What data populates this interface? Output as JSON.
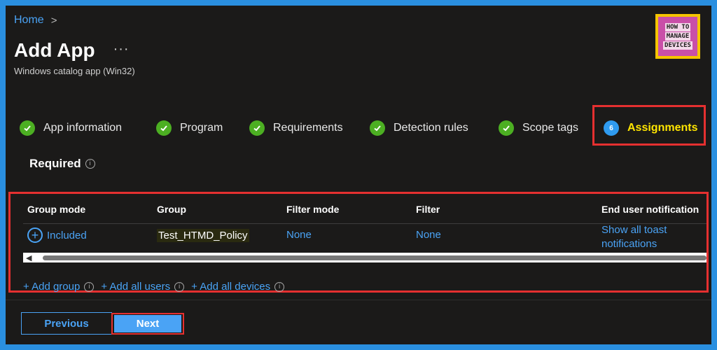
{
  "breadcrumb": {
    "home": "Home",
    "separator": ">"
  },
  "page": {
    "title": "Add App",
    "more": "···",
    "subtitle": "Windows catalog app (Win32)"
  },
  "logo": {
    "line1": "HOW TO",
    "line2": "MANAGE",
    "line3": "DEVICES"
  },
  "steps": [
    {
      "label": "App information",
      "state": "complete"
    },
    {
      "label": "Program",
      "state": "complete"
    },
    {
      "label": "Requirements",
      "state": "complete"
    },
    {
      "label": "Detection rules",
      "state": "complete"
    },
    {
      "label": "Scope tags",
      "state": "complete"
    },
    {
      "label": "Assignments",
      "state": "active",
      "number": "6"
    }
  ],
  "section": {
    "title": "Required",
    "info": "i"
  },
  "table": {
    "columns": [
      "Group mode",
      "Group",
      "Filter mode",
      "Filter",
      "End user notification"
    ],
    "row": {
      "group_mode": "Included",
      "group": "Test_HTMD_Policy",
      "filter_mode": "None",
      "filter": "None",
      "notification_line1": "Show all toast",
      "notification_line2": "notifications"
    }
  },
  "add_links": {
    "add_group": "+ Add group",
    "add_all_users": "+ Add all users",
    "add_all_devices": "+ Add all devices"
  },
  "buttons": {
    "previous": "Previous",
    "next": "Next"
  },
  "colors": {
    "accent": "#4aa3f5",
    "success": "#4caf22",
    "highlight": "#e53030",
    "active_text": "#ffe500"
  }
}
